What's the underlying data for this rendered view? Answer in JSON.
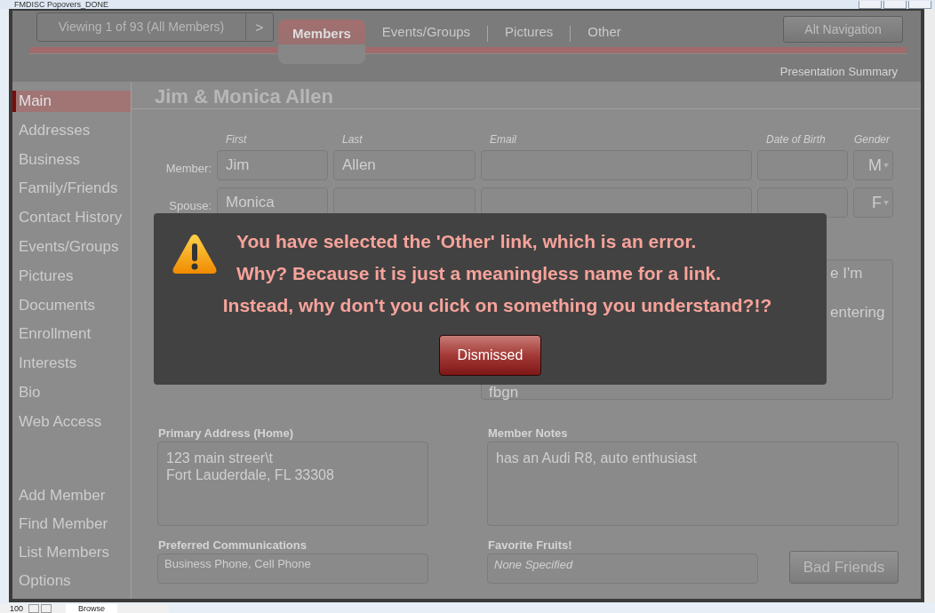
{
  "window": {
    "title": "FMDISC Popovers_DONE"
  },
  "header": {
    "record_nav": {
      "label": "Viewing 1 of 93 (All Members)",
      "next": ">"
    },
    "tabs": [
      {
        "label": "Members",
        "selected": true
      },
      {
        "label": "Events/Groups",
        "selected": false
      },
      {
        "label": "Pictures",
        "selected": false
      },
      {
        "label": "Other",
        "selected": false
      }
    ],
    "alt_nav": "Alt Navigation",
    "summary_link": "Presentation Summary"
  },
  "sidebar": {
    "items": [
      {
        "label": "Main",
        "selected": true
      },
      {
        "label": "Addresses",
        "selected": false
      },
      {
        "label": "Business",
        "selected": false
      },
      {
        "label": "Family/Friends",
        "selected": false
      },
      {
        "label": "Contact History",
        "selected": false
      },
      {
        "label": "Events/Groups",
        "selected": false
      },
      {
        "label": "Pictures",
        "selected": false
      },
      {
        "label": "Documents",
        "selected": false
      },
      {
        "label": "Enrollment",
        "selected": false
      },
      {
        "label": "Interests",
        "selected": false
      },
      {
        "label": "Bio",
        "selected": false
      },
      {
        "label": "Web Access",
        "selected": false
      }
    ],
    "actions": [
      "Add Member",
      "Find Member",
      "List Members",
      "Options"
    ]
  },
  "record": {
    "title": "Jim & Monica Allen",
    "columns": [
      "First",
      "Last",
      "Email",
      "Date of Birth",
      "Gender"
    ],
    "rows": [
      {
        "label": "Member:",
        "first": "Jim",
        "last": "Allen",
        "gender": "M"
      },
      {
        "label": "Spouse:",
        "first": "Monica",
        "gender": "F"
      }
    ],
    "bio_lines": [
      {
        "text": "e I'm",
        "cut": true
      },
      {
        "text": "entering",
        "cut": true
      },
      {
        "text": "fbgn",
        "cut": false
      }
    ]
  },
  "address": {
    "label": "Primary Address (Home)",
    "lines": [
      "123 main streer\\t",
      "Fort Lauderdale, FL 33308"
    ]
  },
  "notes": {
    "label": "Member Notes",
    "value": "has an Audi R8, auto enthusiast"
  },
  "communications": {
    "label": "Preferred Communications",
    "value": "Business Phone, Cell Phone"
  },
  "fruits": {
    "label": "Favorite Fruits!",
    "placeholder": "None Specified"
  },
  "bad_friends_button": "Bad Friends",
  "dialog": {
    "lines": [
      "You have selected the 'Other' link, which is an error.",
      "Why? Because it is just a meaningless name for a link.",
      "Instead, why don't you click on something you understand?!?"
    ],
    "button": "Dismissed"
  },
  "status_bar": {
    "zoom": "100",
    "mode": "Browse"
  }
}
